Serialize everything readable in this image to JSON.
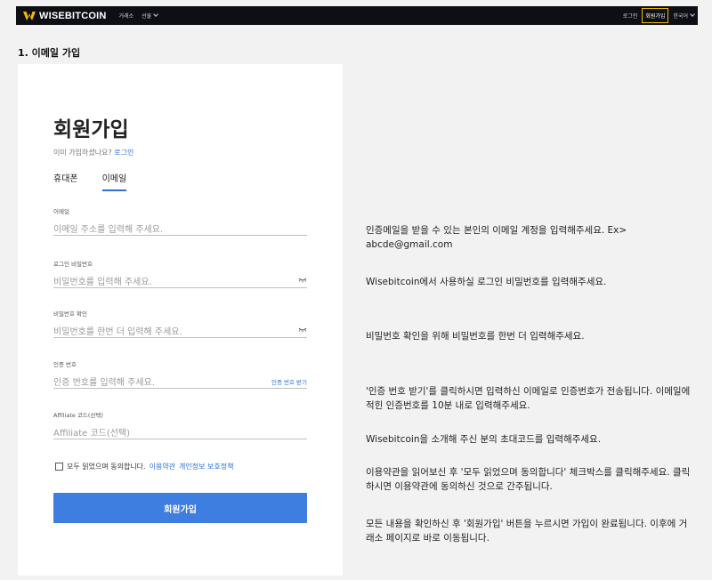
{
  "navbar": {
    "logo": "WISEBITCOIN",
    "links": [
      "거래소",
      "선물"
    ],
    "login": "로그인",
    "signup": "회원가입",
    "language": "한국어"
  },
  "section_title": "1. 이메일 가입",
  "form": {
    "title": "회원가입",
    "already_text": "이미 가입하셨나요?",
    "login_link": "로그인",
    "tabs": [
      "휴대폰",
      "이메일"
    ],
    "active_tab": "이메일",
    "fields": [
      {
        "label": "이메일",
        "placeholder": "이메일 주소를 입력해 주세요."
      },
      {
        "label": "로그인 비밀번호",
        "placeholder": "비밀번호를 입력해 주세요."
      },
      {
        "label": "비밀번호 확인",
        "placeholder": "비밀번호를 한번 더 입력해 주세요."
      },
      {
        "label": "인증 번호",
        "placeholder": "인증 번호를 입력해 주세요.",
        "action": "인증 번호 받기"
      },
      {
        "label": "Affiliate 코드(선택)",
        "placeholder": "Affiliate 코드(선택)"
      }
    ],
    "agree_text": "모두 읽었으며 동의합니다.",
    "terms_link": "이용약관",
    "privacy_link": "개인정보 보호정책",
    "submit": "회원가입"
  },
  "notes": [
    "인증메일을 받을 수 있는 본인의 이메일 계정을 입력해주세요. Ex> abcde@gmail.com",
    "Wisebitcoin에서 사용하실 로그인 비밀번호를 입력해주세요.",
    "비밀번호 확인을 위해 비밀번호를 한번 더 입력해주세요.",
    "'인증 번호 받기'를 클릭하시면 입력하신 이메일로 인증번호가 전송됩니다. 이메일에 적힌 인증번호를 10분 내로 입력해주세요.",
    "Wisebitcoin을 소개해 주신 분의 초대코드를 입력해주세요.",
    "이용약관을 읽어보신 후 '모두 읽었으며 동의합니다' 체크박스를 클릭해주세요. 클릭하시면 이용약관에 동의하신 것으로 간주됩니다.",
    "모든 내용을 확인하신 후 '회원가입' 버튼을 누르시면 가입이 완료됩니다. 이후에 거래소 페이지로 바로 이동됩니다."
  ],
  "colors": {
    "accent": "#3d7ee0",
    "link": "#2b6fd8",
    "brand_yellow": "#f0b90b",
    "navbar_bg": "#0d0f14"
  }
}
